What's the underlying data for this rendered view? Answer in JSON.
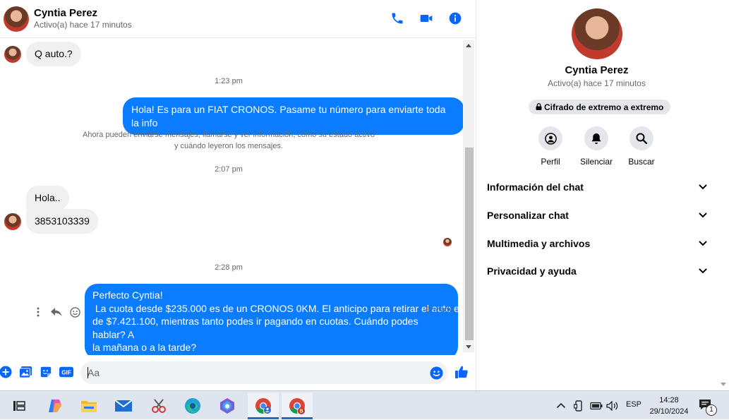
{
  "chat": {
    "name": "Cyntia Perez",
    "status": "Activo(a) hace 17 minutos"
  },
  "messages": {
    "m1": "Q auto.?",
    "ts1": "1:23 pm",
    "m2": "Hola! Es para un FIAT CRONOS. Pasame tu número para enviarte toda la info",
    "sys_line1": "Ahora pueden enviarse mensajes, llamarse y ver información, como su estado activo",
    "sys_line2": "y cuándo leyeron los mensajes.",
    "ts2": "2:07 pm",
    "m3": "Hola..",
    "m4": "3853103339",
    "ts3": "2:28 pm",
    "m5_line1": "Perfecto Cyntia!",
    "m5_line2": " La cuota desde $235.000 es de un CRONOS 0KM. El anticipo para retirar el auto es",
    "m5_line3": "de $7.421.100, mientras tanto podes ir pagando en cuotas. Cuándo podes hablar? A",
    "m5_line4": "la mañana o a la tarde?",
    "sent": "Enviado"
  },
  "composer": {
    "placeholder": "Aa"
  },
  "panel": {
    "name": "Cyntia Perez",
    "status": "Activo(a) hace 17 minutos",
    "e2e": "Cifrado de extremo a extremo",
    "actions": [
      "Perfil",
      "Silenciar",
      "Buscar"
    ],
    "sections": [
      "Información del chat",
      "Personalizar chat",
      "Multimedia y archivos",
      "Privacidad y ayuda"
    ]
  },
  "taskbar": {
    "lang": "ESP",
    "time": "14:28",
    "date": "29/10/2024",
    "notif_count": "1"
  },
  "colors": {
    "accent": "#0a7cff",
    "messenger_icon": "#0866ff"
  },
  "icons": [
    "phone-icon",
    "video-icon",
    "info-icon",
    "plus-icon",
    "image-icon",
    "sticker-icon",
    "gif-icon",
    "emoji-icon",
    "like-icon",
    "lock-icon",
    "profile-icon",
    "bell-icon",
    "search-icon",
    "chevron-down-icon"
  ]
}
